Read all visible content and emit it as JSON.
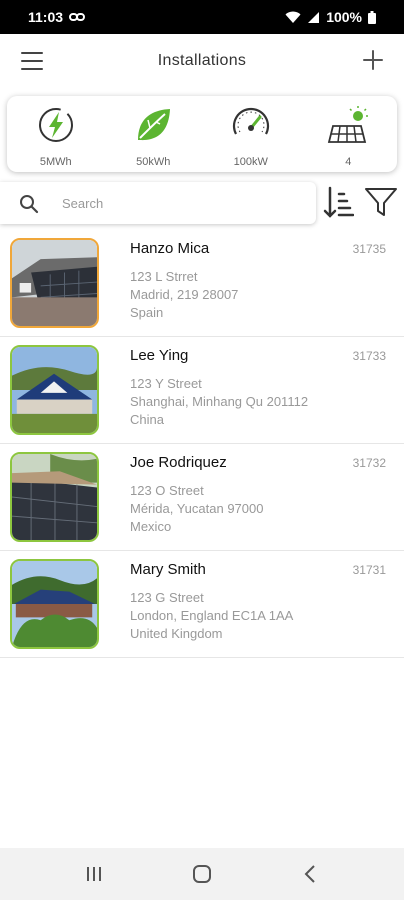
{
  "status": {
    "time": "11:03",
    "battery": "100%"
  },
  "header": {
    "title": "Installations"
  },
  "stats": [
    {
      "icon": "lightning-icon",
      "value": "5MWh"
    },
    {
      "icon": "leaf-icon",
      "value": "50kWh"
    },
    {
      "icon": "speedometer-icon",
      "value": "100kW"
    },
    {
      "icon": "solar-panel-icon",
      "value": "4"
    }
  ],
  "search": {
    "placeholder": "Search",
    "value": ""
  },
  "installations": [
    {
      "name": "Hanzo Mica",
      "id": "31735",
      "line1": "123 L Strret",
      "line2": "Madrid, 219 28007",
      "line3": "Spain"
    },
    {
      "name": "Lee Ying",
      "id": "31733",
      "line1": "123 Y Street",
      "line2": "Shanghai, Minhang Qu 201112",
      "line3": "China"
    },
    {
      "name": "Joe Rodriquez",
      "id": "31732",
      "line1": "123 O Street",
      "line2": "Mérida, Yucatan 97000",
      "line3": "Mexico"
    },
    {
      "name": "Mary Smith",
      "id": "31731",
      "line1": "123 G Street",
      "line2": "London, England EC1A 1AA",
      "line3": "United Kingdom"
    }
  ],
  "colors": {
    "accent_green": "#5cb531",
    "thumb_border_green": "#8dc63f",
    "thumb_border_orange": "#f0a73a"
  }
}
